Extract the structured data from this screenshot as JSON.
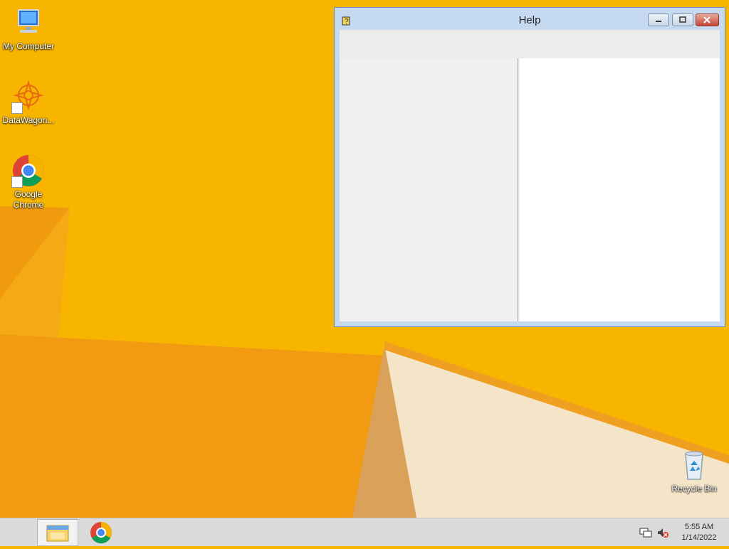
{
  "desktop": {
    "icons": [
      {
        "label": "My Computer"
      },
      {
        "label": "DataWagon..."
      },
      {
        "label": "Google Chrome"
      },
      {
        "label": "Recycle Bin"
      }
    ]
  },
  "window": {
    "title": "Help",
    "controls": {
      "minimize": "minimize-icon",
      "maximize": "maximize-icon",
      "close": "close-icon"
    }
  },
  "taskbar": {
    "pinned": [
      "file-explorer-icon",
      "chrome-icon"
    ],
    "tray": [
      "network-icon",
      "volume-muted-icon"
    ],
    "clock": {
      "time": "5:55 AM",
      "date": "1/14/2022"
    }
  },
  "colors": {
    "wallpaper": "#f6b400",
    "window_frame": "#c5daf0",
    "close_button": "#c4463a"
  }
}
